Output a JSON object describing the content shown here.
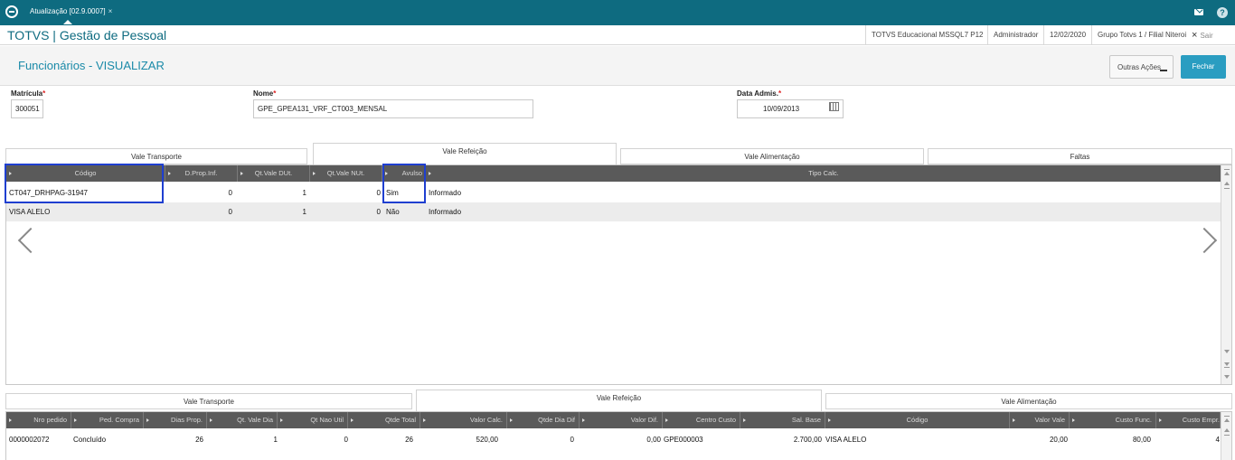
{
  "topbar": {
    "tab_label": "Atualização [02.9.0007]",
    "tab_close": "×",
    "help": "?"
  },
  "header": {
    "title": "TOTVS | Gestão de Pessoal",
    "env": "TOTVS Educacional MSSQL7 P12",
    "user": "Administrador",
    "date": "12/02/2020",
    "branch": "Grupo Totvs 1 / Filial Niteroi",
    "logout_icon": "×",
    "logout": "Sair"
  },
  "page": {
    "title": "Funcionários - VISUALIZAR",
    "other_actions": "Outras Ações",
    "close": "Fechar"
  },
  "form": {
    "matricula_label": "Matrícula",
    "matricula_value": "300051",
    "nome_label": "Nome",
    "nome_value": "GPE_GPEA131_VRF_CT003_MENSAL",
    "data_label": "Data Admis.",
    "data_value": "10/09/2013",
    "required_mark": "*"
  },
  "top_tabs": [
    "Vale Transporte",
    "Vale Refeição",
    "Vale Alimentação",
    "Faltas"
  ],
  "top_grid": {
    "columns": [
      "Código",
      "D.Prop.Inf.",
      "Qt.Vale DUt.",
      "Qt.Vale NUt.",
      "Avulso",
      "Tipo Calc."
    ],
    "rows": [
      [
        "CT047_DRHPAG-31947",
        "0",
        "1",
        "0",
        "Sim",
        "Informado"
      ],
      [
        "VISA ALELO",
        "0",
        "1",
        "0",
        "Não",
        "Informado"
      ]
    ]
  },
  "bottom_tabs": [
    "Vale Transporte",
    "Vale Refeição",
    "Vale Alimentação"
  ],
  "bottom_grid": {
    "columns": [
      "Nro pedido",
      "Ped. Compra",
      "Dias Prop.",
      "Qt. Vale Dia",
      "Qt Nao Util",
      "Qtde Total",
      "Valor Calc.",
      "Qtde Dia Dif",
      "Valor Dif.",
      "Centro Custo",
      "Sal. Base",
      "Código",
      "Valor Vale",
      "Custo Func.",
      "Custo Empr."
    ],
    "rows": [
      [
        "0000002072",
        "Concluído",
        "26",
        "1",
        "0",
        "26",
        "520,00",
        "0",
        "0,00",
        "GPE000003",
        "2.700,00",
        "VISA ALELO",
        "20,00",
        "80,00",
        "4"
      ]
    ]
  },
  "colors": {
    "topbar": "#0e6b80",
    "accent": "#2a9dc1",
    "highlight": "#1f3fd0",
    "grid_header": "#5a5a5a"
  },
  "icons": [
    "totvs-logo-icon",
    "mail-icon",
    "help-icon",
    "calendar-icon",
    "chevron-left-icon",
    "chevron-right-icon",
    "sort-arrow-icon"
  ]
}
